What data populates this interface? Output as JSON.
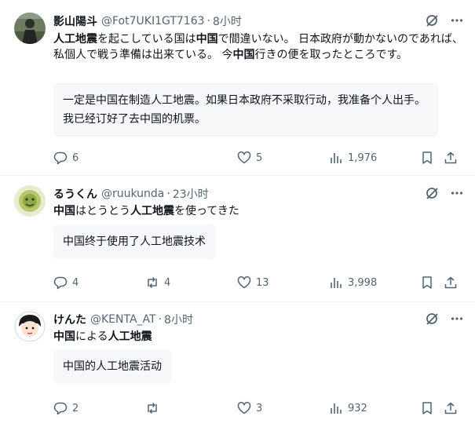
{
  "posts": [
    {
      "name": "影山陽斗",
      "handle": "@Fot7UKI1GT7163",
      "dot": "·",
      "time": "8小时",
      "body_parts": [
        {
          "t": "人工地震",
          "b": true
        },
        {
          "t": "を起こしている国は",
          "b": false
        },
        {
          "t": "中国",
          "b": true
        },
        {
          "t": "で間違いない。 日本政府が動かないのであれば、私個人で戦う準備は出来ている。 今",
          "b": false
        },
        {
          "t": "中国",
          "b": true
        },
        {
          "t": "行きの便を取ったところです。",
          "b": false
        }
      ],
      "translation": "一定是中国在制造人工地震。如果日本政府不采取行动，我准备个人出手。我已经订好了去中国的机票。",
      "replies": "6",
      "reposts": "",
      "likes": "5",
      "views": "1,976"
    },
    {
      "name": "るうくん",
      "handle": "@ruukunda",
      "dot": "·",
      "time": "23小时",
      "body_parts": [
        {
          "t": "中国",
          "b": true
        },
        {
          "t": "はとうとう",
          "b": false
        },
        {
          "t": "人工地震",
          "b": true
        },
        {
          "t": "を使ってきた",
          "b": false
        }
      ],
      "translation": "中国终于使用了人工地震技术",
      "replies": "4",
      "reposts": "4",
      "likes": "13",
      "views": "3,998"
    },
    {
      "name": "けんた",
      "handle": "@KENTA_AT",
      "dot": "·",
      "time": "8小时",
      "body_parts": [
        {
          "t": "中国",
          "b": true
        },
        {
          "t": "による",
          "b": false
        },
        {
          "t": "人工地震",
          "b": true
        }
      ],
      "translation": "中国的人工地震活动",
      "replies": "2",
      "reposts": "",
      "likes": "3",
      "views": "932"
    }
  ],
  "icons": {
    "translate": "grok-slash-icon",
    "more": "more-icon",
    "reply": "reply-icon",
    "repost": "repost-icon",
    "like": "heart-icon",
    "views": "views-icon",
    "bookmark": "bookmark-icon",
    "share": "share-icon"
  },
  "colors": {
    "text": "#0f1419",
    "muted": "#536471",
    "divider": "#eff3f4",
    "translation_bg": "#f5f7f8"
  }
}
